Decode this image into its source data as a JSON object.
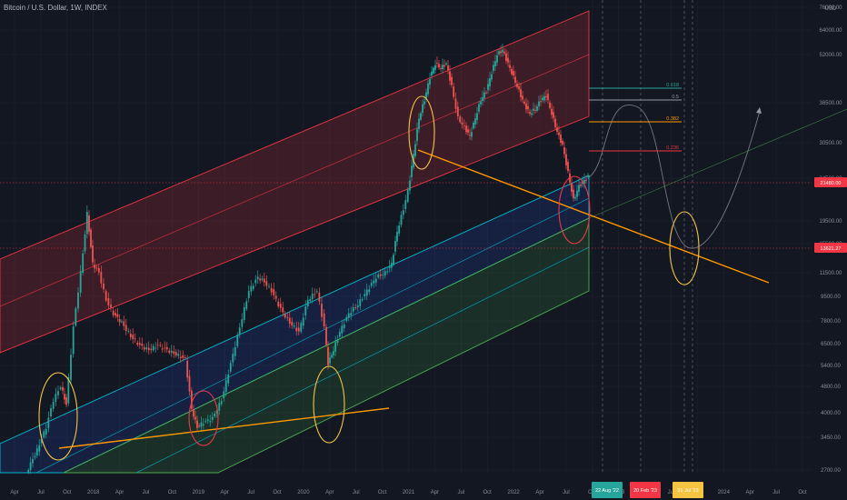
{
  "header": {
    "symbol_title": "Bitcoin / U.S. Dollar, 1W, INDEX"
  },
  "colors": {
    "background": "#131722",
    "grid": "#1e222d",
    "up_candle": "#26a69a",
    "down_candle": "#ef5350",
    "red_channel": "#f23645",
    "blue_channel": "#00bcd4",
    "green_channel": "#4caf50",
    "orange_line": "#ff9800",
    "yellow_circle": "#f5c542",
    "red_circle": "#f23645",
    "projection": "#9598a1",
    "fib_green": "#26a69a",
    "fib_orange": "#ff9800",
    "fib_red": "#f23645"
  },
  "price_axis": {
    "unit": "USD",
    "ticks": [
      "76000.00",
      "64000.00",
      "52000.00",
      "36500.00",
      "30500.00",
      "24500.00",
      "19500.00",
      "15500.00",
      "11500.00",
      "9500.00",
      "7800.00",
      "6500.00",
      "5400.00",
      "4800.00",
      "4000.00",
      "3450.00",
      "2700.00"
    ],
    "current_price": "21480.00",
    "target_price": "13621.27"
  },
  "time_axis": {
    "labels": [
      "Apr",
      "Jul",
      "Oct",
      "2018",
      "Apr",
      "Jul",
      "Oct",
      "2019",
      "Apr",
      "Jul",
      "Oct",
      "2020",
      "Apr",
      "Jul",
      "Oct",
      "2021",
      "Apr",
      "Jul",
      "Oct",
      "2022",
      "Apr",
      "Jul",
      "Oct",
      "2023",
      "Apr",
      "Jul",
      "Oct",
      "2024",
      "Apr",
      "Jul",
      "Oct"
    ],
    "badges": [
      {
        "text": "22 Aug '22",
        "color": "#26a69a"
      },
      {
        "text": "20 Feb '23",
        "color": "#f23645"
      },
      {
        "text": "31 Jul '23",
        "color": "#f5c542"
      }
    ]
  },
  "fib_levels": [
    {
      "label": "0.618",
      "color": "#26a69a"
    },
    {
      "label": "0.5",
      "color": "#9598a1"
    },
    {
      "label": "0.382",
      "color": "#ff9800"
    },
    {
      "label": "0.236",
      "color": "#f23645"
    }
  ],
  "chart_data": {
    "type": "candlestick",
    "title": "Bitcoin / U.S. Dollar, 1W, INDEX",
    "x": [
      "2017-04",
      "2017-07",
      "2017-10",
      "2018-01",
      "2018-04",
      "2018-07",
      "2018-10",
      "2019-01",
      "2019-04",
      "2019-07",
      "2019-10",
      "2020-01",
      "2020-04",
      "2020-07",
      "2020-10",
      "2021-01",
      "2021-04",
      "2021-07",
      "2021-10",
      "2022-01",
      "2022-04",
      "2022-07",
      "2022-08"
    ],
    "series": [
      {
        "values": [
          1300,
          2500,
          6000,
          13000,
          8500,
          7000,
          6400,
          3700,
          5300,
          11000,
          8300,
          8000,
          6800,
          11000,
          13500,
          33000,
          58000,
          35000,
          61000,
          43000,
          40000,
          21000,
          23500
        ]
      }
    ],
    "y_scale": "log",
    "ylim": [
      2700,
      76000
    ],
    "grid": true,
    "annotations": [
      "regression channel (red / blue / green)",
      "orange trend lines",
      "circled touch points",
      "fib retracement levels",
      "projected path"
    ]
  }
}
